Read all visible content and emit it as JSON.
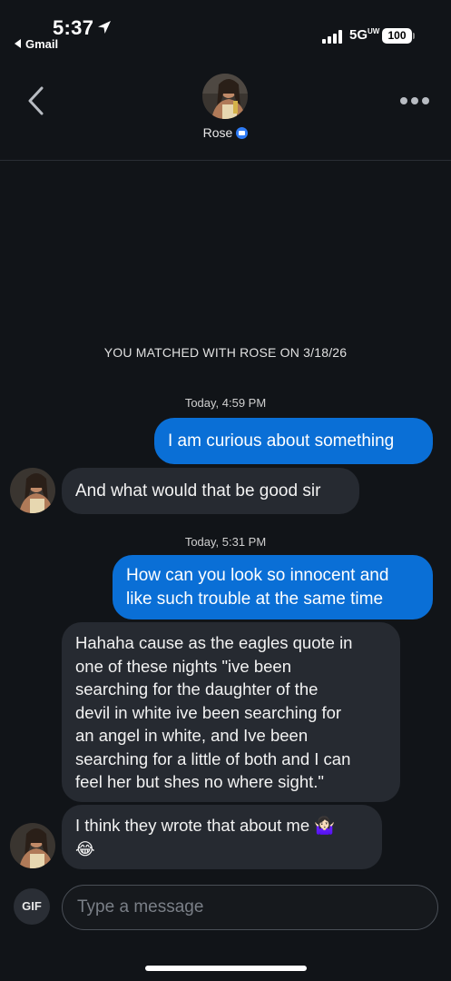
{
  "status_bar": {
    "time": "5:37",
    "back_app": "Gmail",
    "network": "5G",
    "network_sup": "UW",
    "battery": "100"
  },
  "header": {
    "name": "Rose",
    "back_icon": "chevron-left-icon",
    "more_icon": "more-horizontal-icon",
    "verified_icon": "verified-badge-icon"
  },
  "chat": {
    "match_notice": "YOU MATCHED WITH ROSE ON 3/18/26",
    "timestamps": [
      "Today, 4:59 PM",
      "Today, 5:31 PM"
    ],
    "messages": [
      {
        "from": "me",
        "lines": [
          "I am curious about something"
        ]
      },
      {
        "from": "them",
        "lines": [
          "And what would that be good sir"
        ]
      },
      {
        "from": "me",
        "lines": [
          "How can you look so innocent and",
          "like such trouble at the same time"
        ]
      },
      {
        "from": "them",
        "lines": [
          "Hahaha cause as the eagles quote in",
          "one of these nights \"ive been",
          "searching for the daughter of the",
          "devil in white ive been searching for",
          "an angel in white, and Ive been",
          "searching for a little of both and I can",
          "feel her but shes no where sight.\""
        ]
      },
      {
        "from": "them",
        "lines": [
          "I think they wrote that about me 🤷🏻‍♀️",
          "😂"
        ]
      }
    ]
  },
  "composer": {
    "gif_label": "GIF",
    "placeholder": "Type a message"
  },
  "colors": {
    "background": "#111418",
    "outgoing_bubble": "#0a6fd6",
    "incoming_bubble": "#262a31",
    "verified": "#2f7cf6"
  }
}
